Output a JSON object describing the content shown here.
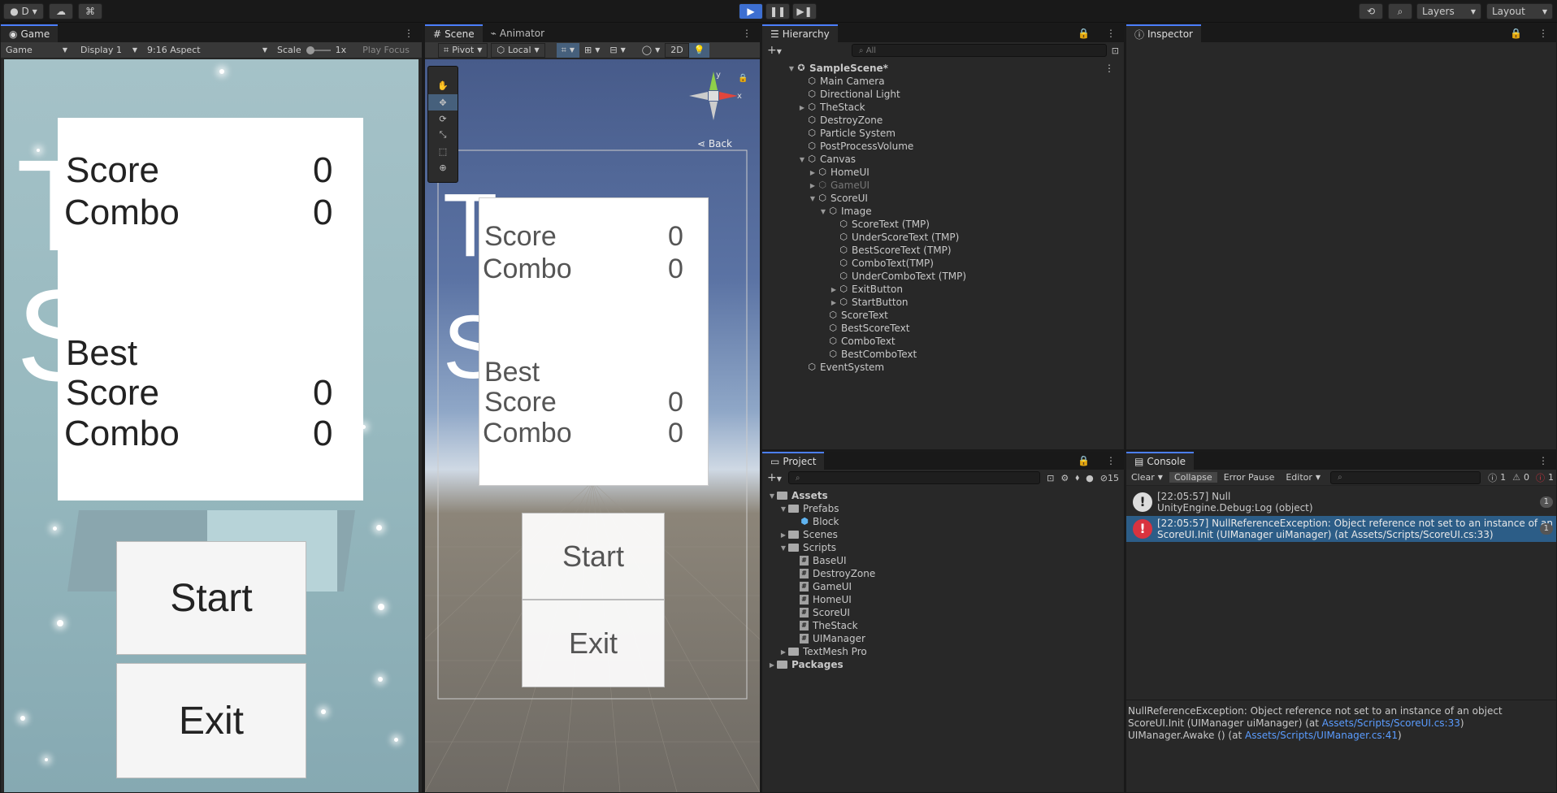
{
  "topbar": {
    "account": "D",
    "play_icon": "play-icon",
    "pause_icon": "pause-icon",
    "step_icon": "step-icon",
    "layers": "Layers",
    "layout": "Layout"
  },
  "game": {
    "tab": "Game",
    "mode": "Game",
    "display": "Display 1",
    "aspect": "9:16 Aspect",
    "scale_label": "Scale",
    "scale_value": "1x",
    "play_focus": "Play Focus",
    "score_label": "Score",
    "score_value": "0",
    "combo_label": "Combo",
    "combo_value": "0",
    "best_label": "Best",
    "best_score_label": "Score",
    "best_score_value": "0",
    "best_combo_label": "Combo",
    "best_combo_value": "0",
    "start": "Start",
    "exit": "Exit",
    "bg_letter_t": "T",
    "bg_letter_s": "S"
  },
  "scene": {
    "tab_scene": "Scene",
    "tab_animator": "Animator",
    "pivot": "Pivot",
    "local": "Local",
    "mode_2d": "2D",
    "back": "Back",
    "axis_x": "x",
    "axis_y": "y",
    "score_label": "Score",
    "score_value": "0",
    "combo_label": "Combo",
    "combo_value": "0",
    "best_label": "Best",
    "best_score_label": "Score",
    "best_score_value": "0",
    "best_combo_label": "Combo",
    "best_combo_value": "0",
    "start": "Start",
    "exit": "Exit",
    "bg_letter_t": "T",
    "bg_letter_s": "S"
  },
  "hierarchy": {
    "tab": "Hierarchy",
    "search_placeholder": "All",
    "scene_name": "SampleScene*",
    "items": [
      {
        "label": "Main Camera",
        "depth": 1,
        "arrow": ""
      },
      {
        "label": "Directional Light",
        "depth": 1,
        "arrow": ""
      },
      {
        "label": "TheStack",
        "depth": 1,
        "arrow": "▶"
      },
      {
        "label": "DestroyZone",
        "depth": 1,
        "arrow": ""
      },
      {
        "label": "Particle System",
        "depth": 1,
        "arrow": ""
      },
      {
        "label": "PostProcessVolume",
        "depth": 1,
        "arrow": ""
      },
      {
        "label": "Canvas",
        "depth": 1,
        "arrow": "▼"
      },
      {
        "label": "HomeUI",
        "depth": 2,
        "arrow": "▶"
      },
      {
        "label": "GameUI",
        "depth": 2,
        "arrow": "▶",
        "dim": true
      },
      {
        "label": "ScoreUI",
        "depth": 2,
        "arrow": "▼"
      },
      {
        "label": "Image",
        "depth": 3,
        "arrow": "▼"
      },
      {
        "label": "ScoreText (TMP)",
        "depth": 4,
        "arrow": ""
      },
      {
        "label": "UnderScoreText (TMP)",
        "depth": 4,
        "arrow": ""
      },
      {
        "label": "BestScoreText (TMP)",
        "depth": 4,
        "arrow": ""
      },
      {
        "label": "ComboText(TMP)",
        "depth": 4,
        "arrow": ""
      },
      {
        "label": "UnderComboText (TMP)",
        "depth": 4,
        "arrow": ""
      },
      {
        "label": "ExitButton",
        "depth": 4,
        "arrow": "▶"
      },
      {
        "label": "StartButton",
        "depth": 4,
        "arrow": "▶"
      },
      {
        "label": "ScoreText",
        "depth": 3,
        "arrow": ""
      },
      {
        "label": "BestScoreText",
        "depth": 3,
        "arrow": ""
      },
      {
        "label": "ComboText",
        "depth": 3,
        "arrow": ""
      },
      {
        "label": "BestComboText",
        "depth": 3,
        "arrow": ""
      },
      {
        "label": "EventSystem",
        "depth": 1,
        "arrow": ""
      }
    ]
  },
  "inspector": {
    "tab": "Inspector"
  },
  "project": {
    "tab": "Project",
    "hidden_count": "15",
    "items": [
      {
        "label": "Assets",
        "depth": 0,
        "arrow": "▼",
        "kind": "folder",
        "bold": true
      },
      {
        "label": "Prefabs",
        "depth": 1,
        "arrow": "▼",
        "kind": "folder"
      },
      {
        "label": "Block",
        "depth": 2,
        "arrow": "",
        "kind": "prefab"
      },
      {
        "label": "Scenes",
        "depth": 1,
        "arrow": "▶",
        "kind": "folder"
      },
      {
        "label": "Scripts",
        "depth": 1,
        "arrow": "▼",
        "kind": "folder"
      },
      {
        "label": "BaseUI",
        "depth": 2,
        "arrow": "",
        "kind": "script"
      },
      {
        "label": "DestroyZone",
        "depth": 2,
        "arrow": "",
        "kind": "script"
      },
      {
        "label": "GameUI",
        "depth": 2,
        "arrow": "",
        "kind": "script"
      },
      {
        "label": "HomeUI",
        "depth": 2,
        "arrow": "",
        "kind": "script"
      },
      {
        "label": "ScoreUI",
        "depth": 2,
        "arrow": "",
        "kind": "script"
      },
      {
        "label": "TheStack",
        "depth": 2,
        "arrow": "",
        "kind": "script"
      },
      {
        "label": "UIManager",
        "depth": 2,
        "arrow": "",
        "kind": "script"
      },
      {
        "label": "TextMesh Pro",
        "depth": 1,
        "arrow": "▶",
        "kind": "folder"
      },
      {
        "label": "Packages",
        "depth": 0,
        "arrow": "▶",
        "kind": "folder",
        "bold": true
      }
    ]
  },
  "console": {
    "tab": "Console",
    "clear": "Clear",
    "collapse": "Collapse",
    "error_pause": "Error Pause",
    "editor": "Editor",
    "log_count": "1",
    "warn_count": "0",
    "error_count": "1",
    "entries": [
      {
        "line1": "[22:05:57] Null",
        "line2": "UnityEngine.Debug:Log (object)",
        "count": "1",
        "type": "log"
      },
      {
        "line1": "[22:05:57] NullReferenceException: Object reference not set to an instance of an object",
        "line2": "ScoreUI.Init (UIManager uiManager) (at Assets/Scripts/ScoreUI.cs:33)",
        "count": "1",
        "type": "error"
      }
    ],
    "detail_line1": "NullReferenceException: Object reference not set to an instance of an object",
    "detail_line2_prefix": "ScoreUI.Init (UIManager uiManager) (at ",
    "detail_line2_link": "Assets/Scripts/ScoreUI.cs:33",
    "detail_line2_suffix": ")",
    "detail_line3_prefix": "UIManager.Awake () (at ",
    "detail_line3_link": "Assets/Scripts/UIManager.cs:41",
    "detail_line3_suffix": ")"
  },
  "colors": {
    "accent": "#4c7fff",
    "selected": "#2c5d87",
    "error": "#d9333f",
    "link": "#5a9cff"
  }
}
